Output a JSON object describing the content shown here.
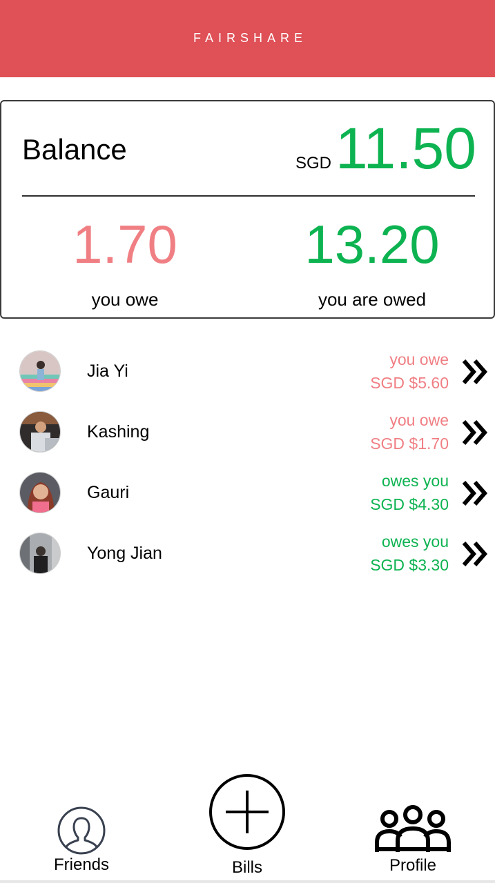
{
  "app": {
    "title": "FAIRSHARE"
  },
  "balance": {
    "label": "Balance",
    "currency": "SGD",
    "amount": "11.50",
    "you_owe_amount": "1.70",
    "you_owe_label": "you owe",
    "owed_amount": "13.20",
    "owed_label": "you are owed"
  },
  "friends": [
    {
      "name": "Jia Yi",
      "status": "you owe",
      "amount": "SGD $5.60",
      "direction": "owe"
    },
    {
      "name": "Kashing",
      "status": "you owe",
      "amount": "SGD $1.70",
      "direction": "owe"
    },
    {
      "name": "Gauri",
      "status": "owes you",
      "amount": "SGD $4.30",
      "direction": "owed"
    },
    {
      "name": "Yong Jian",
      "status": "owes you",
      "amount": "SGD $3.30",
      "direction": "owed"
    }
  ],
  "nav": {
    "friends_label": "Friends",
    "bills_label": "Bills",
    "profile_label": "Profile"
  },
  "colors": {
    "header": "#df5057",
    "positive": "#0db351",
    "negative": "#f07f84"
  },
  "icons": {
    "friends": "user-silhouette-icon",
    "bills": "plus-circle-icon",
    "profile": "group-icon",
    "row_action": "double-chevron-right-icon"
  }
}
